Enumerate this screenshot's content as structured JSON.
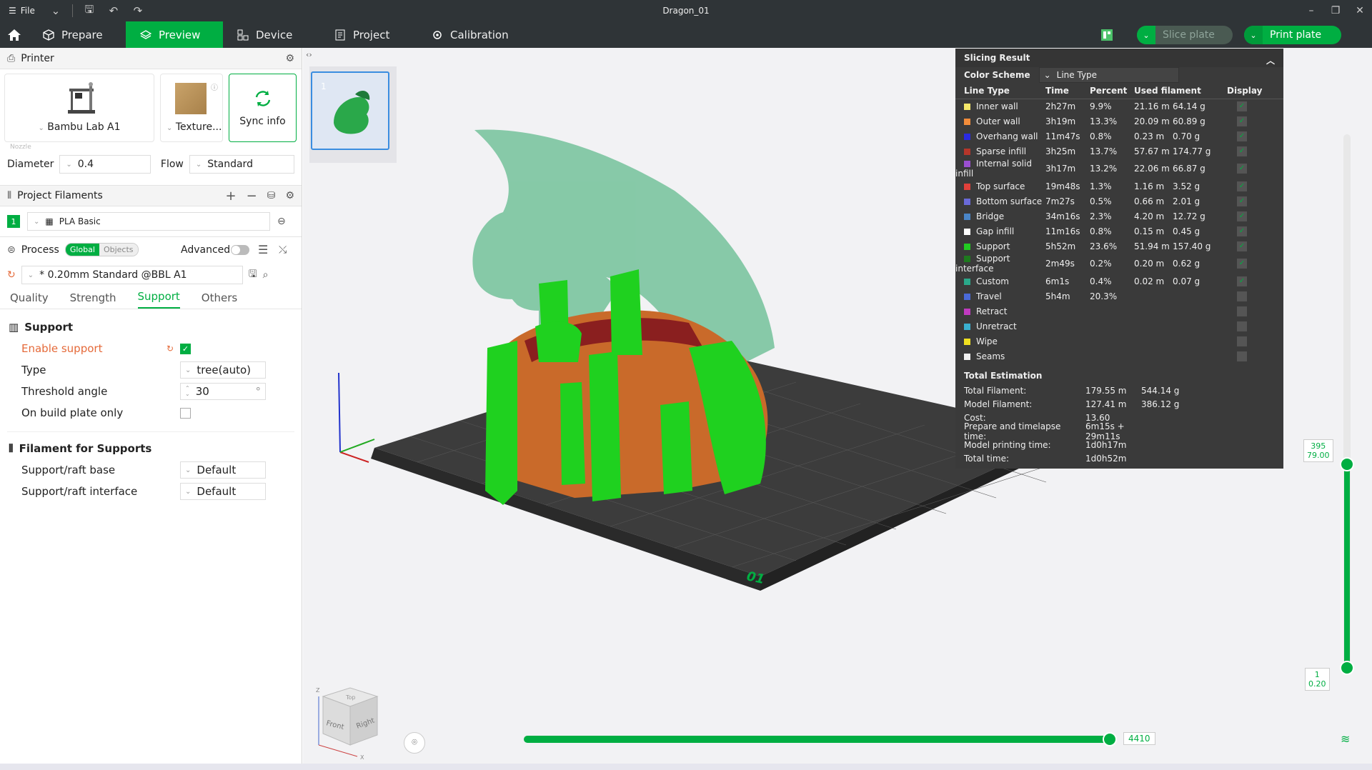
{
  "titlebar": {
    "file_label": "File",
    "window_title": "Dragon_01"
  },
  "tabs": [
    {
      "label": "Prepare"
    },
    {
      "label": "Preview"
    },
    {
      "label": "Device"
    },
    {
      "label": "Project"
    },
    {
      "label": "Calibration"
    }
  ],
  "toolbar": {
    "slice_label": "Slice plate",
    "print_label": "Print plate"
  },
  "printer": {
    "header": "Printer",
    "name": "Bambu Lab A1",
    "plate": "Texture...",
    "sync_label": "Sync info",
    "nozzle_caption": "Nozzle",
    "diameter_label": "Diameter",
    "diameter_value": "0.4",
    "flow_label": "Flow",
    "flow_value": "Standard"
  },
  "filaments": {
    "header": "Project Filaments",
    "items": [
      {
        "index": "1",
        "name": "PLA Basic"
      }
    ]
  },
  "process": {
    "header": "Process",
    "seg_global": "Global",
    "seg_objects": "Objects",
    "advanced_label": "Advanced",
    "preset": "* 0.20mm Standard @BBL A1",
    "tabs": [
      "Quality",
      "Strength",
      "Support",
      "Others"
    ],
    "active_tab": "Support"
  },
  "support": {
    "title": "Support",
    "enable_label": "Enable support",
    "enable_checked": true,
    "type_label": "Type",
    "type_value": "tree(auto)",
    "threshold_label": "Threshold angle",
    "threshold_value": "30",
    "threshold_unit": "°",
    "build_plate_label": "On build plate only",
    "filament_title": "Filament for Supports",
    "base_label": "Support/raft base",
    "base_value": "Default",
    "interface_label": "Support/raft interface",
    "interface_value": "Default"
  },
  "plates": [
    {
      "number": "1"
    }
  ],
  "slicing_result": {
    "title": "Slicing Result",
    "color_scheme_label": "Color Scheme",
    "color_scheme_value": "Line Type",
    "columns": [
      "Line Type",
      "Time",
      "Percent",
      "Used filament",
      "Display"
    ],
    "rows": [
      {
        "name": "Inner wall",
        "color": "#f5e86a",
        "time": "2h27m",
        "percent": "9.9%",
        "length": "21.16 m",
        "weight": "64.14 g",
        "display": true
      },
      {
        "name": "Outer wall",
        "color": "#f28c3a",
        "time": "3h19m",
        "percent": "13.3%",
        "length": "20.09 m",
        "weight": "60.89 g",
        "display": true
      },
      {
        "name": "Overhang wall",
        "color": "#2a2ae0",
        "time": "11m47s",
        "percent": "0.8%",
        "length": "0.23 m",
        "weight": "0.70 g",
        "display": true
      },
      {
        "name": "Sparse infill",
        "color": "#b6362a",
        "time": "3h25m",
        "percent": "13.7%",
        "length": "57.67 m",
        "weight": "174.77 g",
        "display": true
      },
      {
        "name": "Internal solid infill",
        "color": "#9a4fd0",
        "time": "3h17m",
        "percent": "13.2%",
        "length": "22.06 m",
        "weight": "66.87 g",
        "display": true
      },
      {
        "name": "Top surface",
        "color": "#e0403a",
        "time": "19m48s",
        "percent": "1.3%",
        "length": "1.16 m",
        "weight": "3.52 g",
        "display": true
      },
      {
        "name": "Bottom surface",
        "color": "#6a6ad8",
        "time": "7m27s",
        "percent": "0.5%",
        "length": "0.66 m",
        "weight": "2.01 g",
        "display": true
      },
      {
        "name": "Bridge",
        "color": "#4a86c8",
        "time": "34m16s",
        "percent": "2.3%",
        "length": "4.20 m",
        "weight": "12.72 g",
        "display": true
      },
      {
        "name": "Gap infill",
        "color": "#ffffff",
        "time": "11m16s",
        "percent": "0.8%",
        "length": "0.15 m",
        "weight": "0.45 g",
        "display": true
      },
      {
        "name": "Support",
        "color": "#22cc22",
        "time": "5h52m",
        "percent": "23.6%",
        "length": "51.94 m",
        "weight": "157.40 g",
        "display": true
      },
      {
        "name": "Support interface",
        "color": "#1e7a1e",
        "time": "2m49s",
        "percent": "0.2%",
        "length": "0.20 m",
        "weight": "0.62 g",
        "display": true
      },
      {
        "name": "Custom",
        "color": "#2aa88a",
        "time": "6m1s",
        "percent": "0.4%",
        "length": "0.02 m",
        "weight": "0.07 g",
        "display": true
      },
      {
        "name": "Travel",
        "color": "#4a6ad8",
        "time": "5h4m",
        "percent": "20.3%",
        "length": "",
        "weight": "",
        "display": false
      },
      {
        "name": "Retract",
        "color": "#c03ac0",
        "time": "",
        "percent": "",
        "length": "",
        "weight": "",
        "display": false
      },
      {
        "name": "Unretract",
        "color": "#3ab0d0",
        "time": "",
        "percent": "",
        "length": "",
        "weight": "",
        "display": false
      },
      {
        "name": "Wipe",
        "color": "#f0e020",
        "time": "",
        "percent": "",
        "length": "",
        "weight": "",
        "display": false
      },
      {
        "name": "Seams",
        "color": "#f0f0f0",
        "time": "",
        "percent": "",
        "length": "",
        "weight": "",
        "display": false
      }
    ],
    "totals_title": "Total Estimation",
    "totals": [
      {
        "label": "Total Filament:",
        "v1": "179.55 m",
        "v2": "544.14 g"
      },
      {
        "label": "Model Filament:",
        "v1": "127.41 m",
        "v2": "386.12 g"
      },
      {
        "label": "Cost:",
        "v1": "13.60",
        "v2": ""
      },
      {
        "label": "Prepare and timelapse time:",
        "v1": "6m15s + 29m11s",
        "v2": ""
      },
      {
        "label": "Model printing time:",
        "v1": "1d0h17m",
        "v2": ""
      },
      {
        "label": "Total time:",
        "v1": "1d0h52m",
        "v2": ""
      }
    ]
  },
  "layer_slider": {
    "top_layer": "395",
    "top_height": "79.00",
    "bottom_layer": "1",
    "bottom_height": "0.20"
  },
  "move_slider": {
    "value": "4410"
  },
  "view_cube": {
    "front": "Front",
    "right": "Right",
    "top": "Top",
    "axis_x": "X",
    "axis_z": "Z"
  },
  "plate_label": "01"
}
